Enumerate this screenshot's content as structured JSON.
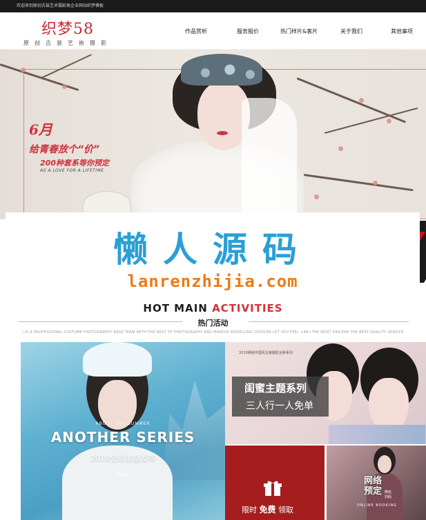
{
  "topbar": {
    "welcome": "欢迎来到原创古装艺术摄影类企业网站织梦模板"
  },
  "header": {
    "logo_text": "织梦58",
    "logo_tagline": "原创古装艺術摄影",
    "nav": [
      "作品赏析",
      "服务报价",
      "热门样片&客片",
      "关于我们",
      "其他事项"
    ]
  },
  "banner": {
    "month": "6月",
    "line1": "给青春放个“价”",
    "line2": "200种套系等你预定",
    "line3": "AS A LOVE FOR A LIFETIME"
  },
  "watermark": {
    "cn": "懒人源码",
    "en": "lanrenzhijia.com"
  },
  "section": {
    "title_en_dark": "HOT MAIN ",
    "title_en_red": "ACTIVITIES",
    "title_cn": "热门活动",
    "desc": "I IS A PROFESSIONAL COSTUME PHOTOGRAPHY BASE TEAM WITH THE BEST OF PHOTOGRAPHY AND MAKEUP MODELLING DIVISION LET YOU FEEL <BR>THE MOST SINCERE THE BEST QUALITY SERVICE"
  },
  "tiles": {
    "a": {
      "small": "ABOUT THE SUMMER",
      "title": "ANOTHER SERIES",
      "sub": "2016全新主题发布",
      "more": "More+"
    },
    "b": {
      "caption": "2016栖城中国风古装摄影全新系列",
      "title": "闺蜜主题系列",
      "sub": "三人行一人免单"
    },
    "c": {
      "prefix": "限时 ",
      "bold": "免费",
      "suffix": " 领取"
    },
    "d": {
      "stamp": "网络\n预定",
      "small": "微信\n扫码",
      "en": "ONLINE BOOKING"
    }
  },
  "colors": {
    "brand_red": "#c8282e",
    "watermark_blue": "#2a9fd6",
    "watermark_orange": "#ee7a18",
    "tile_red": "#a61d1d"
  }
}
